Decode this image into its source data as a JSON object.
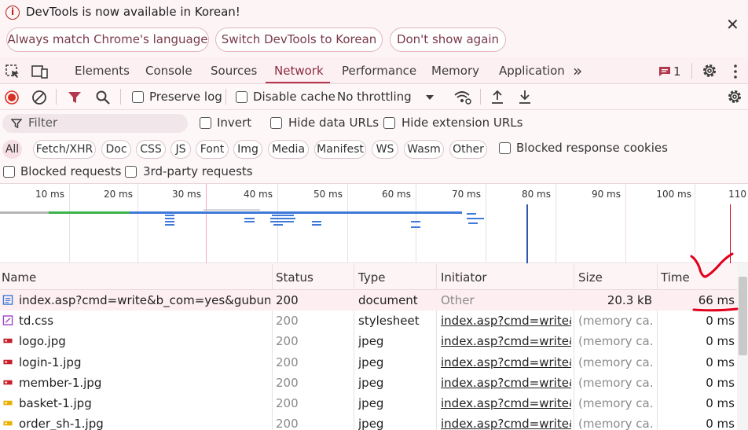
{
  "infobar": {
    "message": "DevTools is now available in Korean!",
    "buttons": [
      "Always match Chrome's language",
      "Switch DevTools to Korean",
      "Don't show again"
    ],
    "close": "✕"
  },
  "tabs": {
    "items": [
      "Elements",
      "Console",
      "Sources",
      "Network",
      "Performance",
      "Memory",
      "Application"
    ],
    "active": "Network",
    "more": "»",
    "issues_count": "1"
  },
  "toolbar": {
    "preserve_log": "Preserve log",
    "disable_cache": "Disable cache",
    "throttling": "No throttling"
  },
  "filter": {
    "placeholder": "Filter",
    "invert": "Invert",
    "hide_data_urls": "Hide data URLs",
    "hide_extension_urls": "Hide extension URLs"
  },
  "types": [
    "All",
    "Fetch/XHR",
    "Doc",
    "CSS",
    "JS",
    "Font",
    "Img",
    "Media",
    "Manifest",
    "WS",
    "Wasm",
    "Other"
  ],
  "blocked_response_cookies": "Blocked response cookies",
  "blocked_requests": "Blocked requests",
  "third_party_requests": "3rd-party requests",
  "timeline": {
    "ticks": [
      "10 ms",
      "20 ms",
      "30 ms",
      "40 ms",
      "50 ms",
      "60 ms",
      "70 ms",
      "80 ms",
      "90 ms",
      "100 ms",
      "110"
    ]
  },
  "table": {
    "headers": [
      "Name",
      "Status",
      "Type",
      "Initiator",
      "Size",
      "Time"
    ],
    "rows": [
      {
        "name": "index.asp?cmd=write&b_com=yes&gubun=...",
        "status": "200",
        "type": "document",
        "initiator": "Other",
        "size": "20.3 kB",
        "time": "66 ms",
        "icon": "document-icon"
      },
      {
        "name": "td.css",
        "status": "200",
        "type": "stylesheet",
        "initiator": "index.asp?cmd=write&b",
        "size": "(memory ca...",
        "time": "0 ms",
        "icon": "css-icon"
      },
      {
        "name": "logo.jpg",
        "status": "200",
        "type": "jpeg",
        "initiator": "index.asp?cmd=write&b",
        "size": "(memory ca...",
        "time": "0 ms",
        "icon": "image-icon"
      },
      {
        "name": "login-1.jpg",
        "status": "200",
        "type": "jpeg",
        "initiator": "index.asp?cmd=write&b",
        "size": "(memory ca...",
        "time": "0 ms",
        "icon": "image-icon"
      },
      {
        "name": "member-1.jpg",
        "status": "200",
        "type": "jpeg",
        "initiator": "index.asp?cmd=write&b",
        "size": "(memory ca...",
        "time": "0 ms",
        "icon": "image-icon"
      },
      {
        "name": "basket-1.jpg",
        "status": "200",
        "type": "jpeg",
        "initiator": "index.asp?cmd=write&b",
        "size": "(memory ca...",
        "time": "0 ms",
        "icon": "image-icon"
      },
      {
        "name": "order_sh-1.jpg",
        "status": "200",
        "type": "jpeg",
        "initiator": "index.asp?cmd=write&b",
        "size": "(memory ca...",
        "time": "0 ms",
        "icon": "image-icon"
      }
    ]
  },
  "colors": {
    "accent": "#b3384e",
    "record": "#d93025",
    "bar": "#3f7ad9",
    "annotation": "#e0001b"
  }
}
